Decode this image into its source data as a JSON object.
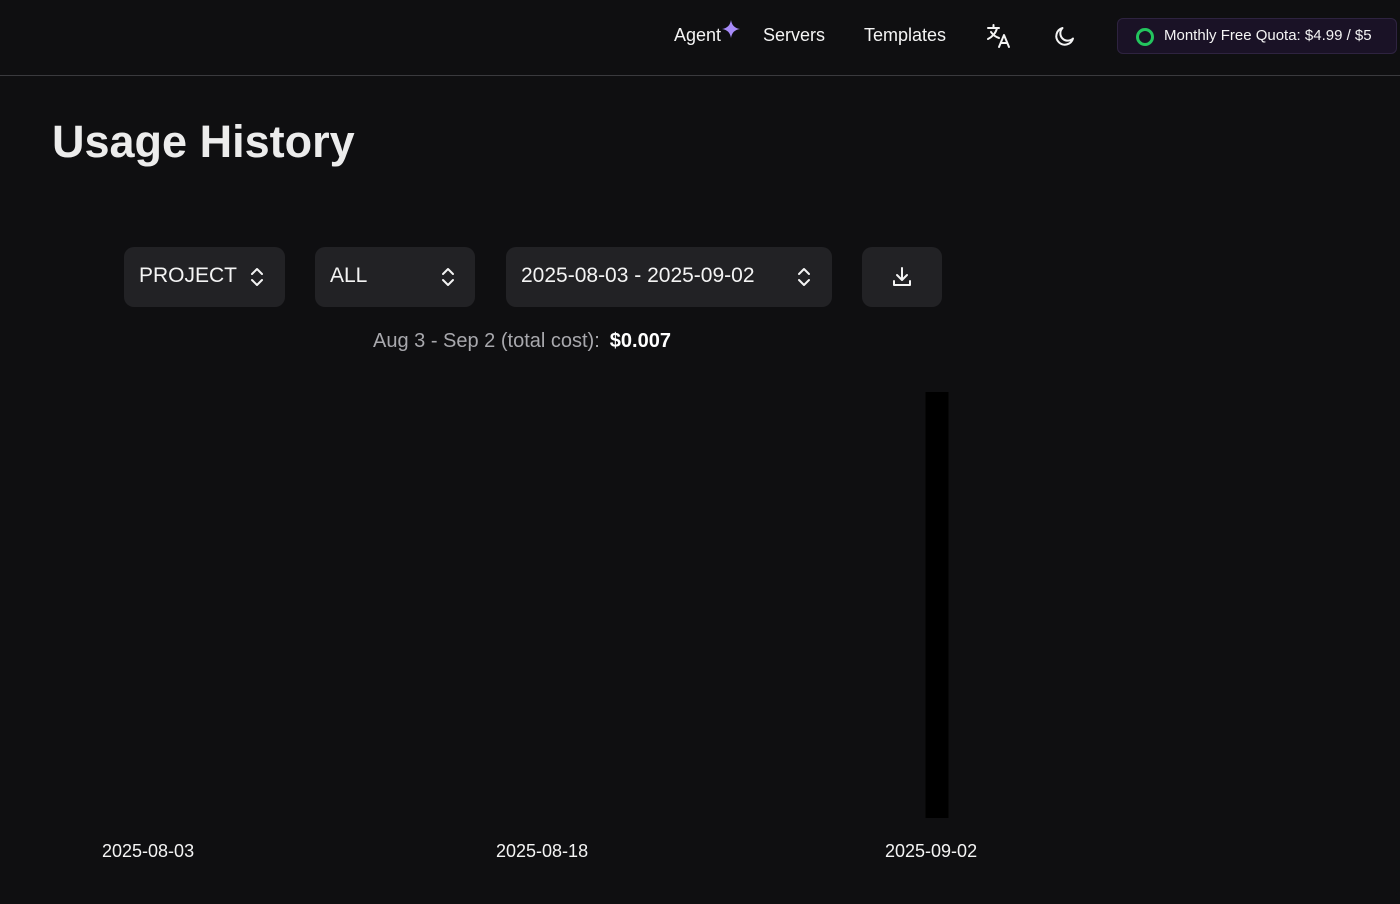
{
  "nav": {
    "agent": "Agent",
    "servers": "Servers",
    "templates": "Templates",
    "translate_icon": "translate-icon",
    "theme_icon": "moon-icon",
    "quota": "Monthly Free Quota: $4.99 / $5",
    "quota_color": "#23c55e",
    "sparkle_color": "#a78bfa"
  },
  "page": {
    "title": "Usage History"
  },
  "filters": {
    "group_by": "PROJECT",
    "scope": "ALL",
    "date_range": "2025-08-03 - 2025-09-02",
    "download_icon": "download-icon"
  },
  "summary": {
    "label": "Aug 3 - Sep 2 (total cost):",
    "value": "$0.007"
  },
  "chart_data": {
    "type": "bar",
    "x_ticks": [
      "2025-08-03",
      "2025-08-18",
      "2025-09-02"
    ],
    "categories": [
      "2025-09-02"
    ],
    "values": [
      0.007
    ],
    "bar_color": "#000000",
    "grid": false
  }
}
